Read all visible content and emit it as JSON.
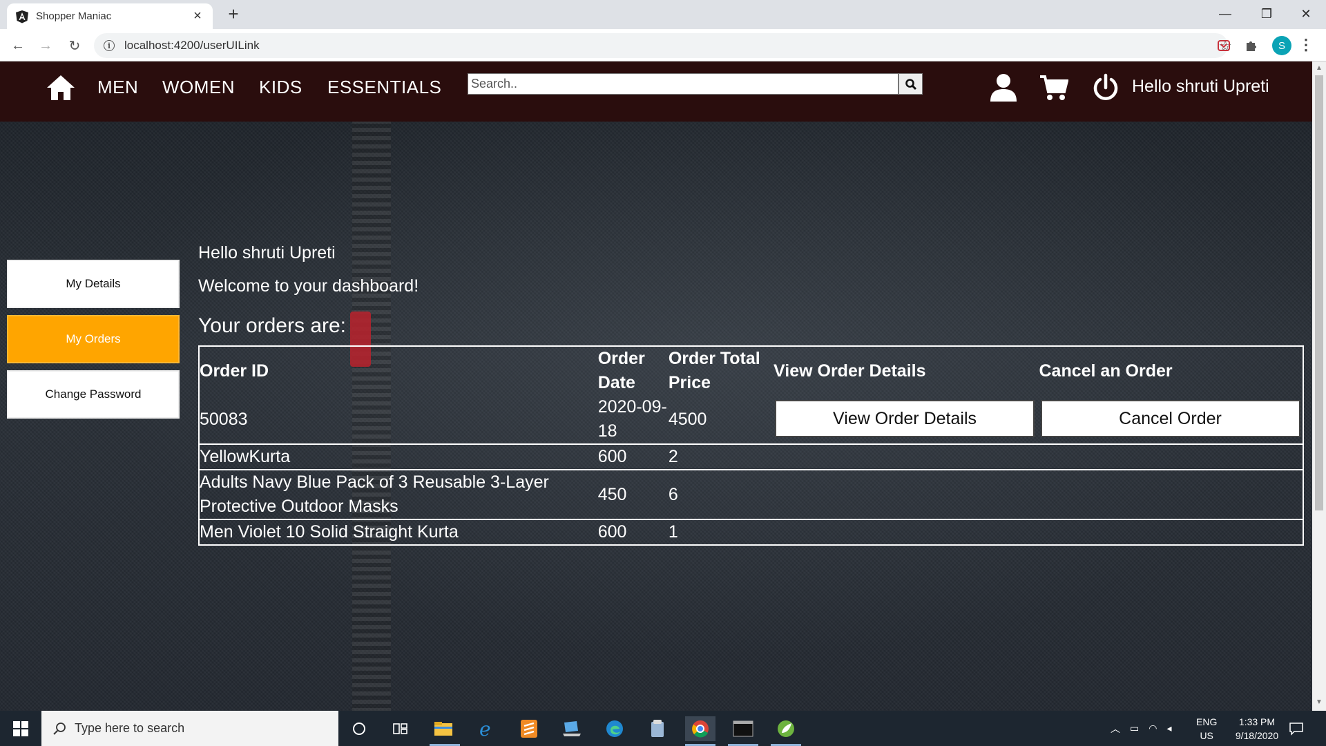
{
  "browser": {
    "tab_title": "Shopper Maniac",
    "url": "localhost:4200/userUILink",
    "profile_initial": "S"
  },
  "nav": {
    "links": [
      "MEN",
      "WOMEN",
      "KIDS",
      "ESSENTIALS"
    ],
    "search_placeholder": "Search..",
    "greeting": "Hello shruti Upreti"
  },
  "sidebar": {
    "items": [
      {
        "label": "My Details",
        "active": false
      },
      {
        "label": "My Orders",
        "active": true
      },
      {
        "label": "Change Password",
        "active": false
      }
    ]
  },
  "main": {
    "hello": "Hello shruti Upreti",
    "welcome": "Welcome to your dashboard!",
    "orders_heading": "Your orders are:",
    "headers": {
      "order_id": "Order ID",
      "order_date": "Order Date",
      "order_total": "Order Total Price",
      "view": "View Order Details",
      "cancel": "Cancel an Order"
    },
    "order": {
      "id": "50083",
      "date": "2020-09-18",
      "total": "4500",
      "view_button": "View Order Details",
      "cancel_button": "Cancel Order"
    },
    "items": [
      {
        "name": "YellowKurta",
        "price": "600",
        "qty": "2"
      },
      {
        "name": "Adults Navy Blue Pack of 3 Reusable 3-Layer Protective Outdoor Masks",
        "price": "450",
        "qty": "6"
      },
      {
        "name": "Men Violet 10 Solid Straight Kurta",
        "price": "600",
        "qty": "1"
      }
    ]
  },
  "taskbar": {
    "search_placeholder": "Type here to search",
    "lang": "ENG",
    "region": "US",
    "time": "1:33 PM",
    "date": "9/18/2020"
  },
  "colors": {
    "nav_bg": "#2a0d0d",
    "active_sidebar": "#ffa500"
  }
}
